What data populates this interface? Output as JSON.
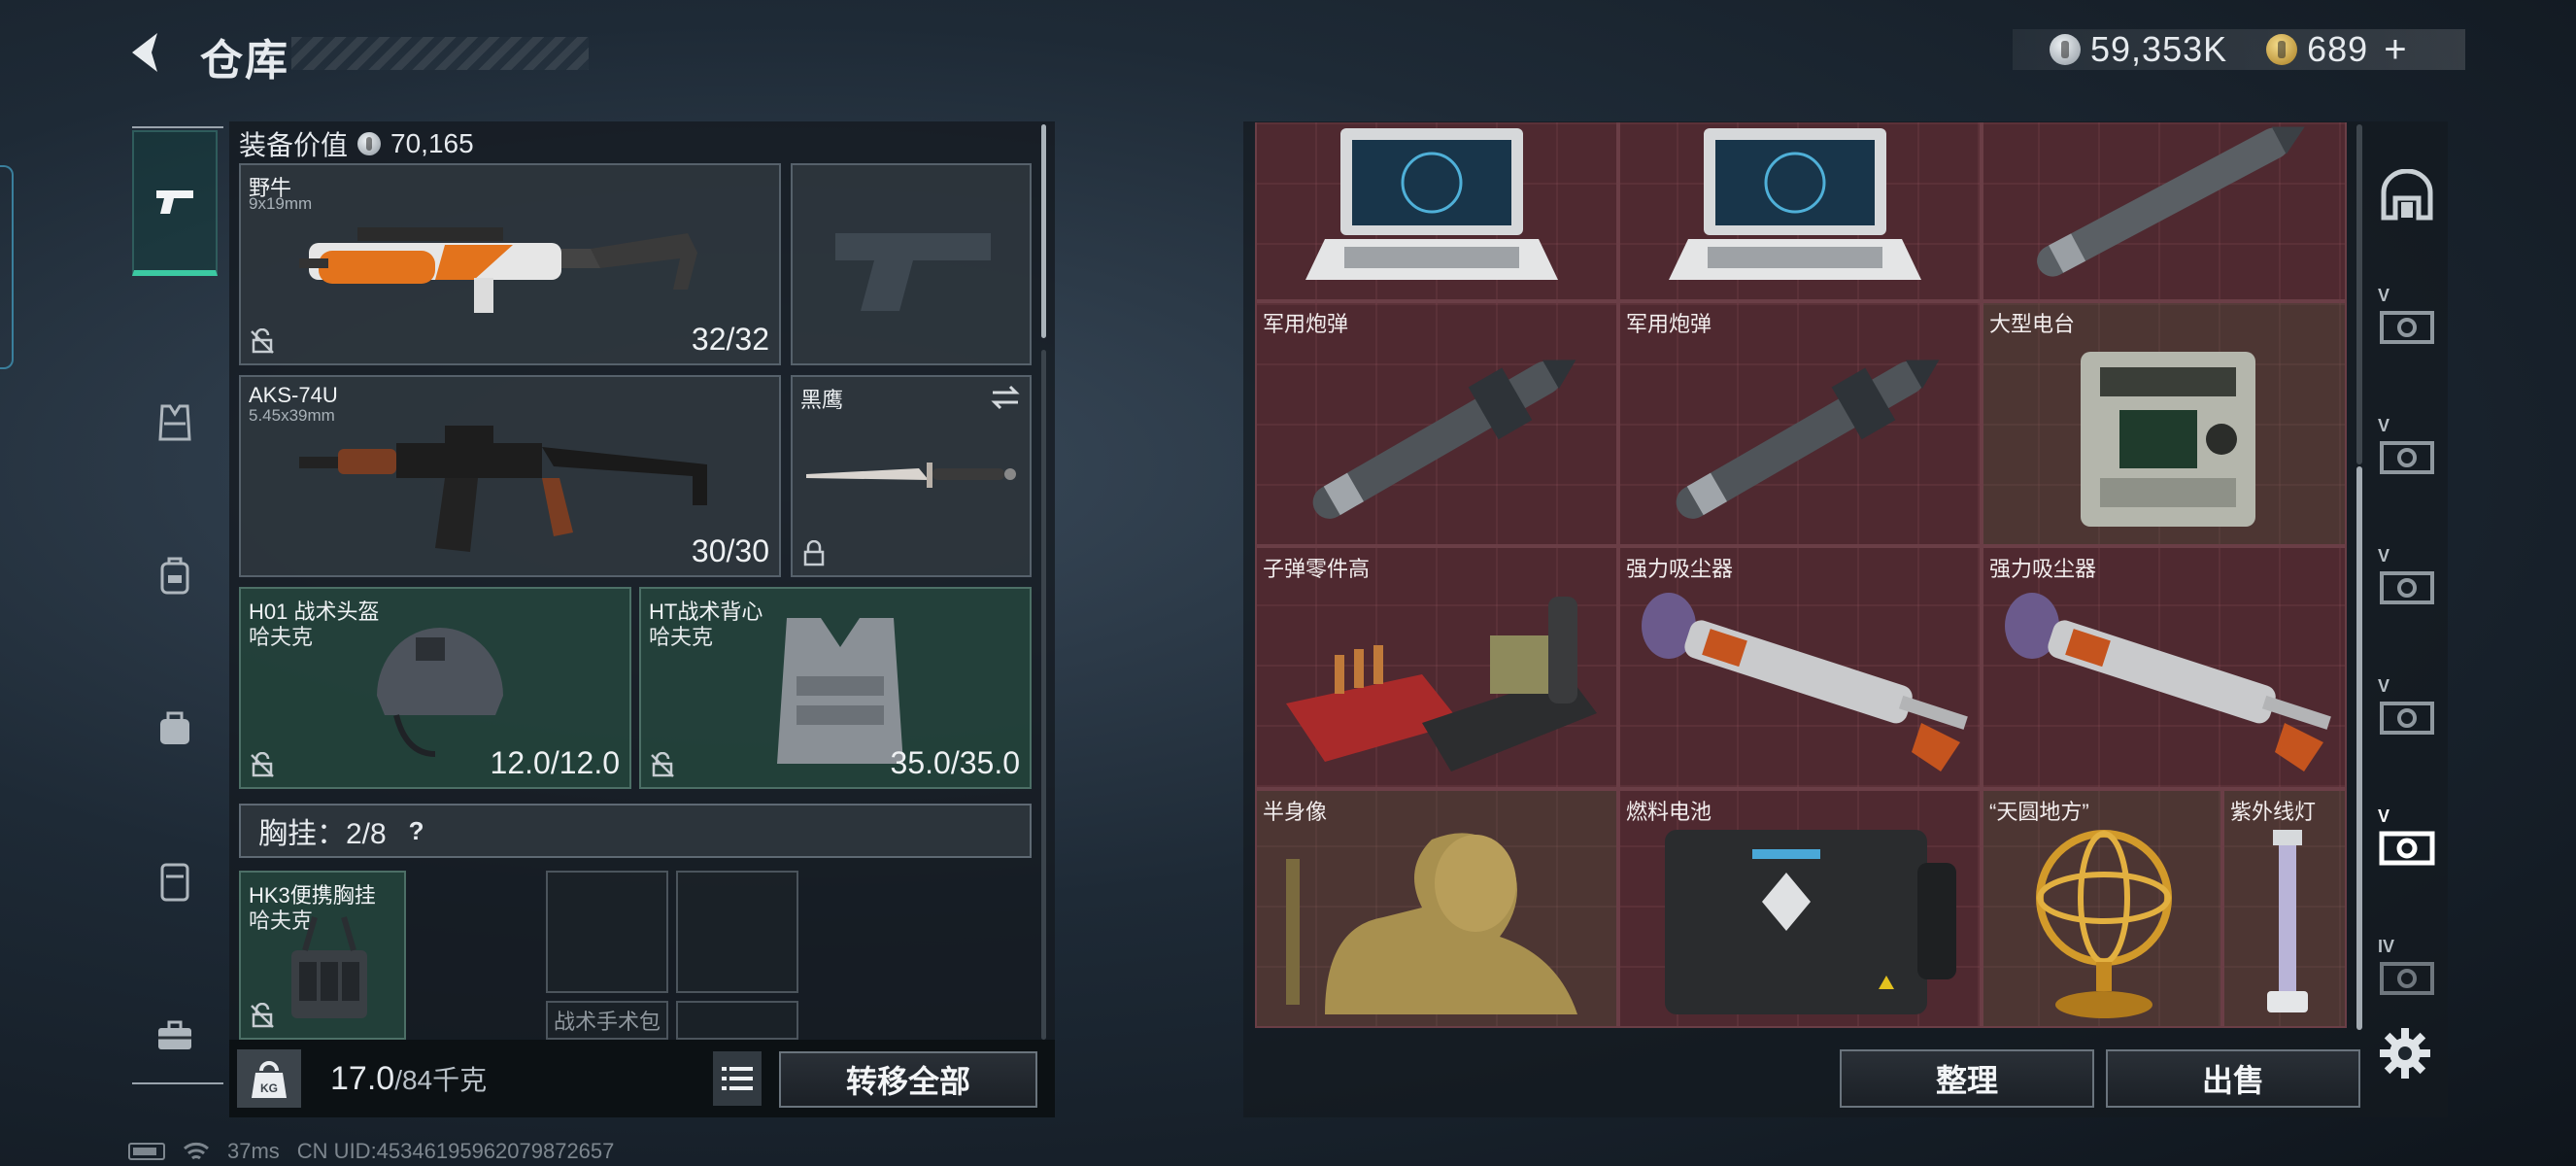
{
  "header": {
    "title": "仓库",
    "silver_amount": "59,353K",
    "gold_amount": "689",
    "gold_add": "+"
  },
  "left_nav": {
    "items": [
      "pistol-icon",
      "armor-vest-icon",
      "backpack-icon",
      "bag-icon",
      "container-icon",
      "toolbox-icon"
    ],
    "active": "pistol-icon"
  },
  "equipment": {
    "value_label": "装备价值",
    "value": "70,165",
    "primary_weapon": {
      "name": "野牛",
      "caliber": "9x19mm",
      "ammo": "32/32"
    },
    "secondary_weapon": {
      "name": "AKS-74U",
      "caliber": "5.45x39mm",
      "ammo": "30/30"
    },
    "melee": {
      "name": "黑鹰"
    },
    "helmet": {
      "name": "H01 战术头盔",
      "brand": "哈夫克",
      "durability": "12.0/12.0"
    },
    "armor": {
      "name": "HT战术背心",
      "brand": "哈夫克",
      "durability": "35.0/35.0"
    },
    "vest_header": "胸挂：2/8",
    "vest_help": "?",
    "chest_rig": {
      "name": "HK3便携胸挂",
      "brand": "哈夫克"
    },
    "surgery_pouch_label": "战术手术包"
  },
  "weight": {
    "kg_label": "KG",
    "current": "17.0",
    "capacity": "/84千克"
  },
  "buttons": {
    "transfer_all": "转移全部",
    "sort": "整理",
    "sell": "出售"
  },
  "status": {
    "ping": "37ms",
    "uid": "CN UID:45346195962079872657"
  },
  "stash_items": [
    {
      "name": "",
      "icon": "laptop"
    },
    {
      "name": "",
      "icon": "laptop"
    },
    {
      "name": "",
      "icon": "missile"
    },
    {
      "name": "军用炮弹",
      "icon": "missile"
    },
    {
      "name": "军用炮弹",
      "icon": "missile"
    },
    {
      "name": "大型电台",
      "icon": "radio"
    },
    {
      "name": "子弹零件高",
      "icon": "ammo-parts"
    },
    {
      "name": "强力吸尘器",
      "icon": "vacuum"
    },
    {
      "name": "强力吸尘器",
      "icon": "vacuum"
    },
    {
      "name": "半身像",
      "icon": "bust"
    },
    {
      "name": "燃料电池",
      "icon": "fuel-cell"
    },
    {
      "name": "“天圆地方”",
      "icon": "armillary-sphere"
    },
    {
      "name": "紫外线灯",
      "icon": "uv-lamp"
    }
  ],
  "right_nav": {
    "items": [
      "safehouse-icon",
      "tier-v-icon",
      "tier-v-icon",
      "tier-v-icon",
      "tier-v-icon",
      "tier-v-icon",
      "tier-iv-icon"
    ],
    "tags": [
      "",
      "V",
      "V",
      "V",
      "V",
      "V",
      "IV"
    ],
    "active_index": 5
  },
  "colors": {
    "accent_green": "#3cc9a2",
    "stash_red": "#4a2a31",
    "equip_green": "#26483e"
  }
}
